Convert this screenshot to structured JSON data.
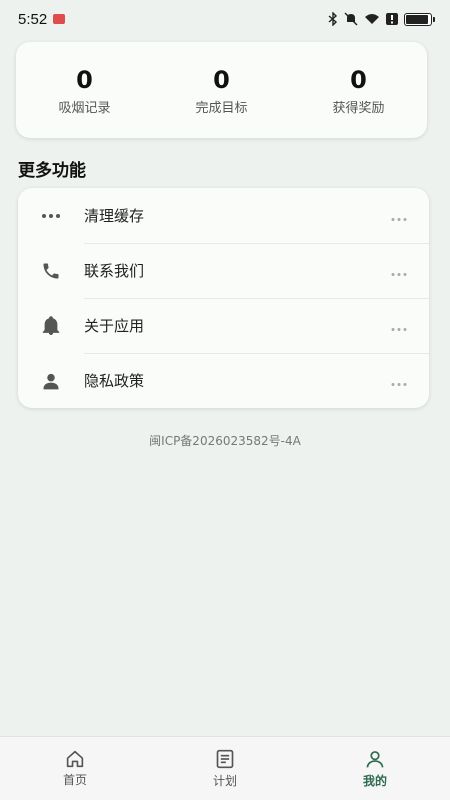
{
  "status_bar": {
    "time": "5:52",
    "icons": [
      "bluetooth-icon",
      "mute-icon",
      "wifi-icon",
      "alert-icon",
      "battery-icon"
    ]
  },
  "stats": [
    {
      "value": "0",
      "label": "吸烟记录"
    },
    {
      "value": "0",
      "label": "完成目标"
    },
    {
      "value": "0",
      "label": "获得奖励"
    }
  ],
  "section_title": "更多功能",
  "menu": [
    {
      "label": "清理缓存",
      "icon": "more-dots-icon"
    },
    {
      "label": "联系我们",
      "icon": "phone-icon"
    },
    {
      "label": "关于应用",
      "icon": "bell-icon"
    },
    {
      "label": "隐私政策",
      "icon": "person-icon"
    }
  ],
  "icp": "闽ICP备2026023582号-4A",
  "tabs": [
    {
      "label": "首页",
      "icon": "home-icon",
      "active": false
    },
    {
      "label": "计划",
      "icon": "list-icon",
      "active": false
    },
    {
      "label": "我的",
      "icon": "user-icon",
      "active": true
    }
  ],
  "colors": {
    "accent": "#2f6b4f",
    "background": "#eef2ee"
  }
}
